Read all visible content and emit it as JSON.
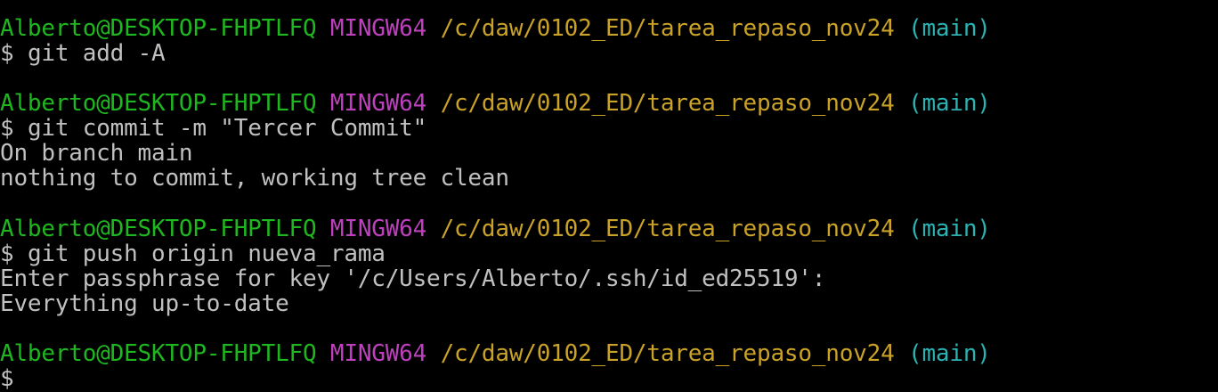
{
  "terminal": {
    "theme": {
      "background": "#000000",
      "user_color": "#1fb71f",
      "env_color": "#bf40bf",
      "path_color": "#c9a227",
      "branch_color": "#2bb3b3",
      "text_color": "#c0c0c0"
    },
    "prompt": {
      "user_host": "Alberto@DESKTOP-FHPTLFQ",
      "env": "MINGW64",
      "path": "/c/daw/0102_ED/tarea_repaso_nov24",
      "branch": "(main)",
      "symbol": "$"
    },
    "blocks": [
      {
        "command": "git add -A",
        "output": []
      },
      {
        "command": "git commit -m \"Tercer Commit\"",
        "output": [
          "On branch main",
          "nothing to commit, working tree clean"
        ]
      },
      {
        "command": "git push origin nueva_rama",
        "output": [
          "Enter passphrase for key '/c/Users/Alberto/.ssh/id_ed25519':",
          "Everything up-to-date"
        ]
      },
      {
        "command": "",
        "output": []
      }
    ]
  }
}
